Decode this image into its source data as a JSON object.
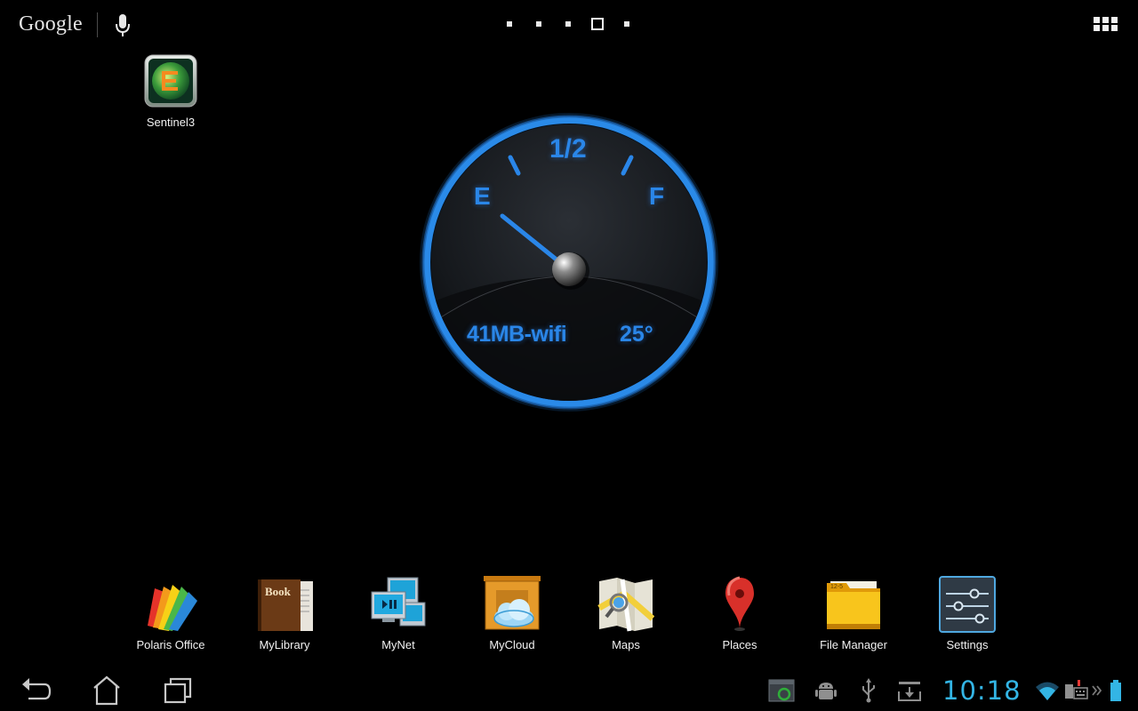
{
  "topbar": {
    "search_brand": "Google",
    "page_count": 5,
    "current_page": 4
  },
  "desktop": {
    "shortcuts": [
      {
        "label": "Sentinel3",
        "icon": "sentinel3-app-icon"
      }
    ]
  },
  "gauge_widget": {
    "label_empty": "E",
    "label_half": "1/2",
    "label_full": "F",
    "network_text": "41MB-wifi",
    "temperature_text": "25°",
    "accent_color": "#2a86e8"
  },
  "dock": {
    "items": [
      {
        "label": "Polaris Office",
        "icon": "polaris-office-icon"
      },
      {
        "label": "MyLibrary",
        "icon": "mylibrary-book-icon",
        "icon_text": "Book"
      },
      {
        "label": "MyNet",
        "icon": "mynet-monitors-icon"
      },
      {
        "label": "MyCloud",
        "icon": "mycloud-icon"
      },
      {
        "label": "Maps",
        "icon": "maps-icon"
      },
      {
        "label": "Places",
        "icon": "places-pin-icon"
      },
      {
        "label": "File Manager",
        "icon": "file-manager-folder-icon",
        "icon_text": "12-5"
      },
      {
        "label": "Settings",
        "icon": "settings-sliders-icon"
      }
    ]
  },
  "systembar": {
    "clock": "10:18",
    "clock_color": "#33b5e5",
    "nav_icons": [
      "back-icon",
      "home-icon",
      "recent-apps-icon"
    ],
    "notification_icons": [
      "screenshot-app-icon",
      "android-debug-icon",
      "usb-icon",
      "download-icon"
    ],
    "status_icons": [
      "wifi-icon",
      "keyboard-icon",
      "battery-icon"
    ]
  }
}
